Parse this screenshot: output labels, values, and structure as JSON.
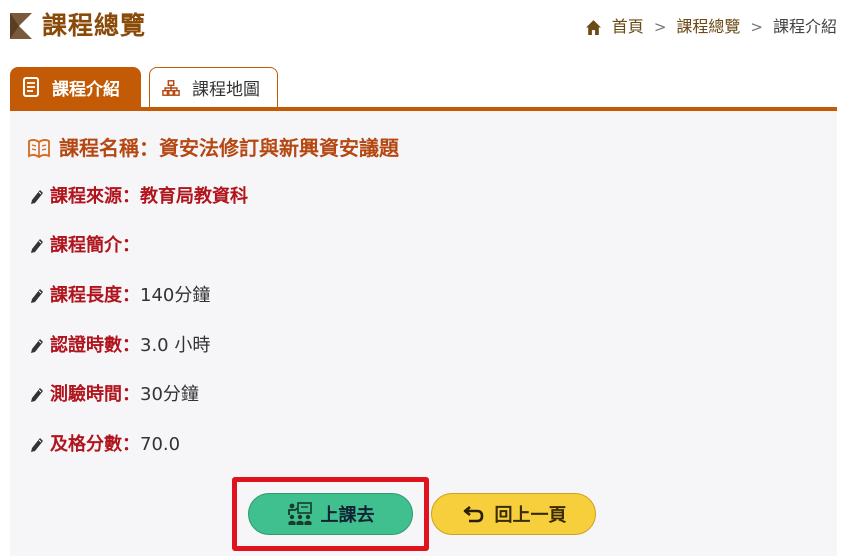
{
  "header": {
    "title": "課程總覽",
    "breadcrumb": [
      "首頁",
      "課程總覽",
      "課程介紹"
    ]
  },
  "tabs": [
    {
      "label": "課程介紹",
      "active": true
    },
    {
      "label": "課程地圖",
      "active": false
    }
  ],
  "course": {
    "name_label": "課程名稱：",
    "name_value": "資安法修訂與新興資安議題",
    "fields": [
      {
        "label": "課程來源：",
        "value": "教育局教資科"
      },
      {
        "label": "課程簡介：",
        "value": ""
      },
      {
        "label": "課程長度：",
        "value": "140分鐘"
      },
      {
        "label": "認證時數：",
        "value": "3.0 小時"
      },
      {
        "label": "測驗時間：",
        "value": "30分鐘"
      },
      {
        "label": "及格分數：",
        "value": "70.0"
      }
    ]
  },
  "buttons": {
    "go_class": "上課去",
    "back": "回上一頁"
  },
  "colors": {
    "brand": "#c25a06",
    "label_red": "#b0141c",
    "go_green": "#3fc08e",
    "back_yellow": "#f7cf3c",
    "highlight_red": "#e0121d"
  }
}
